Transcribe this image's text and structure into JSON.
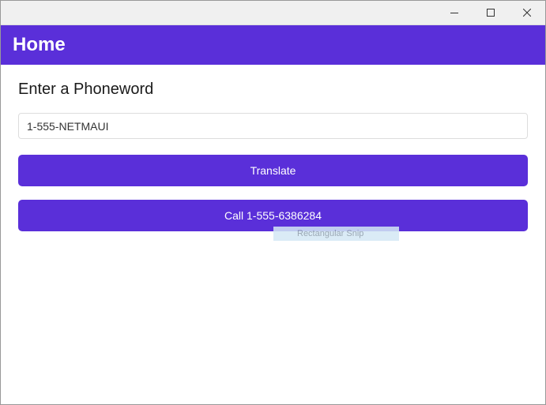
{
  "window": {
    "title": ""
  },
  "header": {
    "title": "Home"
  },
  "main": {
    "prompt_label": "Enter a Phoneword",
    "input_value": "1-555-NETMAUI",
    "translate_button_label": "Translate",
    "call_button_label": "Call 1-555-6386284"
  },
  "overlay": {
    "snip_text": "Rectangular Snip"
  },
  "colors": {
    "accent": "#5A2FD9"
  }
}
